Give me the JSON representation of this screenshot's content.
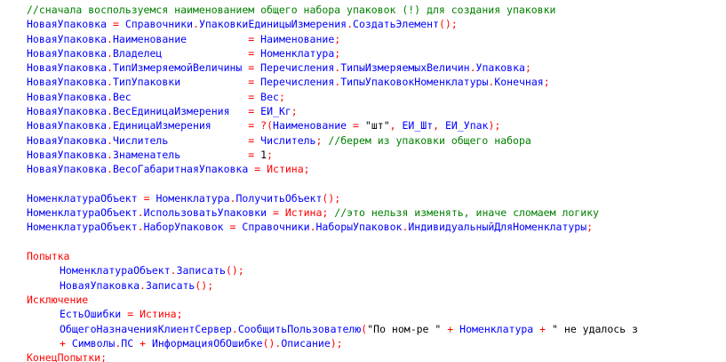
{
  "colors": {
    "identifier": "#0000ff",
    "operator": "#ff0000",
    "keyword": "#ff0000",
    "string": "#000000",
    "comment": "#008000",
    "background": "#ffffff"
  },
  "lines": [
    {
      "indent": 1,
      "tokens": [
        {
          "t": "cmt",
          "v": "//сначала воспользуемся наименованием общего набора упаковок (!) для создания упаковки"
        }
      ]
    },
    {
      "indent": 1,
      "tokens": [
        {
          "t": "ident",
          "v": "НоваяУпаковка"
        },
        {
          "t": "sp",
          "v": " "
        },
        {
          "t": "op",
          "v": "="
        },
        {
          "t": "sp",
          "v": " "
        },
        {
          "t": "ident",
          "v": "Справочники"
        },
        {
          "t": "op",
          "v": "."
        },
        {
          "t": "ident",
          "v": "УпаковкиЕдиницыИзмерения"
        },
        {
          "t": "op",
          "v": "."
        },
        {
          "t": "ident",
          "v": "СоздатьЭлемент"
        },
        {
          "t": "op",
          "v": "();"
        }
      ]
    },
    {
      "indent": 1,
      "tokens": [
        {
          "t": "ident",
          "v": "НоваяУпаковка"
        },
        {
          "t": "op",
          "v": "."
        },
        {
          "t": "ident",
          "v": "Наименование"
        },
        {
          "t": "sp",
          "v": "          "
        },
        {
          "t": "op",
          "v": "="
        },
        {
          "t": "sp",
          "v": " "
        },
        {
          "t": "ident",
          "v": "Наименование"
        },
        {
          "t": "op",
          "v": ";"
        }
      ]
    },
    {
      "indent": 1,
      "tokens": [
        {
          "t": "ident",
          "v": "НоваяУпаковка"
        },
        {
          "t": "op",
          "v": "."
        },
        {
          "t": "ident",
          "v": "Владелец"
        },
        {
          "t": "sp",
          "v": "              "
        },
        {
          "t": "op",
          "v": "="
        },
        {
          "t": "sp",
          "v": " "
        },
        {
          "t": "ident",
          "v": "Номенклатура"
        },
        {
          "t": "op",
          "v": ";"
        }
      ]
    },
    {
      "indent": 1,
      "tokens": [
        {
          "t": "ident",
          "v": "НоваяУпаковка"
        },
        {
          "t": "op",
          "v": "."
        },
        {
          "t": "ident",
          "v": "ТипИзмеряемойВеличины"
        },
        {
          "t": "sp",
          "v": " "
        },
        {
          "t": "op",
          "v": "="
        },
        {
          "t": "sp",
          "v": " "
        },
        {
          "t": "ident",
          "v": "Перечисления"
        },
        {
          "t": "op",
          "v": "."
        },
        {
          "t": "ident",
          "v": "ТипыИзмеряемыхВеличин"
        },
        {
          "t": "op",
          "v": "."
        },
        {
          "t": "ident",
          "v": "Упаковка"
        },
        {
          "t": "op",
          "v": ";"
        }
      ]
    },
    {
      "indent": 1,
      "tokens": [
        {
          "t": "ident",
          "v": "НоваяУпаковка"
        },
        {
          "t": "op",
          "v": "."
        },
        {
          "t": "ident",
          "v": "ТипУпаковки"
        },
        {
          "t": "sp",
          "v": "           "
        },
        {
          "t": "op",
          "v": "="
        },
        {
          "t": "sp",
          "v": " "
        },
        {
          "t": "ident",
          "v": "Перечисления"
        },
        {
          "t": "op",
          "v": "."
        },
        {
          "t": "ident",
          "v": "ТипыУпаковокНоменклатуры"
        },
        {
          "t": "op",
          "v": "."
        },
        {
          "t": "ident",
          "v": "Конечная"
        },
        {
          "t": "op",
          "v": ";"
        }
      ]
    },
    {
      "indent": 1,
      "tokens": [
        {
          "t": "ident",
          "v": "НоваяУпаковка"
        },
        {
          "t": "op",
          "v": "."
        },
        {
          "t": "ident",
          "v": "Вес"
        },
        {
          "t": "sp",
          "v": "                   "
        },
        {
          "t": "op",
          "v": "="
        },
        {
          "t": "sp",
          "v": " "
        },
        {
          "t": "ident",
          "v": "Вес"
        },
        {
          "t": "op",
          "v": ";"
        }
      ]
    },
    {
      "indent": 1,
      "tokens": [
        {
          "t": "ident",
          "v": "НоваяУпаковка"
        },
        {
          "t": "op",
          "v": "."
        },
        {
          "t": "ident",
          "v": "ВесЕдиницаИзмерения"
        },
        {
          "t": "sp",
          "v": "   "
        },
        {
          "t": "op",
          "v": "="
        },
        {
          "t": "sp",
          "v": " "
        },
        {
          "t": "ident",
          "v": "ЕИ_Кг"
        },
        {
          "t": "op",
          "v": ";"
        }
      ]
    },
    {
      "indent": 1,
      "tokens": [
        {
          "t": "ident",
          "v": "НоваяУпаковка"
        },
        {
          "t": "op",
          "v": "."
        },
        {
          "t": "ident",
          "v": "ЕдиницаИзмерения"
        },
        {
          "t": "sp",
          "v": "      "
        },
        {
          "t": "op",
          "v": "="
        },
        {
          "t": "sp",
          "v": " "
        },
        {
          "t": "op",
          "v": "?("
        },
        {
          "t": "ident",
          "v": "Наименование"
        },
        {
          "t": "sp",
          "v": " "
        },
        {
          "t": "op",
          "v": "="
        },
        {
          "t": "sp",
          "v": " "
        },
        {
          "t": "str",
          "v": "\"шт\""
        },
        {
          "t": "op",
          "v": ","
        },
        {
          "t": "sp",
          "v": " "
        },
        {
          "t": "ident",
          "v": "ЕИ_Шт"
        },
        {
          "t": "op",
          "v": ","
        },
        {
          "t": "sp",
          "v": " "
        },
        {
          "t": "ident",
          "v": "ЕИ_Упак"
        },
        {
          "t": "op",
          "v": ");"
        }
      ]
    },
    {
      "indent": 1,
      "tokens": [
        {
          "t": "ident",
          "v": "НоваяУпаковка"
        },
        {
          "t": "op",
          "v": "."
        },
        {
          "t": "ident",
          "v": "Числитель"
        },
        {
          "t": "sp",
          "v": "             "
        },
        {
          "t": "op",
          "v": "="
        },
        {
          "t": "sp",
          "v": " "
        },
        {
          "t": "ident",
          "v": "Числитель"
        },
        {
          "t": "op",
          "v": ";"
        },
        {
          "t": "sp",
          "v": " "
        },
        {
          "t": "cmt",
          "v": "//берем из упаковки общего набора"
        }
      ]
    },
    {
      "indent": 1,
      "tokens": [
        {
          "t": "ident",
          "v": "НоваяУпаковка"
        },
        {
          "t": "op",
          "v": "."
        },
        {
          "t": "ident",
          "v": "Знаменатель"
        },
        {
          "t": "sp",
          "v": "           "
        },
        {
          "t": "op",
          "v": "="
        },
        {
          "t": "sp",
          "v": " "
        },
        {
          "t": "num",
          "v": "1"
        },
        {
          "t": "op",
          "v": ";"
        }
      ]
    },
    {
      "indent": 1,
      "tokens": [
        {
          "t": "ident",
          "v": "НоваяУпаковка"
        },
        {
          "t": "op",
          "v": "."
        },
        {
          "t": "ident",
          "v": "ВесоГабаритнаяУпаковка"
        },
        {
          "t": "sp",
          "v": " "
        },
        {
          "t": "op",
          "v": "="
        },
        {
          "t": "sp",
          "v": " "
        },
        {
          "t": "kw",
          "v": "Истина"
        },
        {
          "t": "op",
          "v": ";"
        }
      ]
    },
    {
      "indent": 1,
      "tokens": []
    },
    {
      "indent": 1,
      "tokens": [
        {
          "t": "ident",
          "v": "НоменклатураОбъект"
        },
        {
          "t": "sp",
          "v": " "
        },
        {
          "t": "op",
          "v": "="
        },
        {
          "t": "sp",
          "v": " "
        },
        {
          "t": "ident",
          "v": "Номенклатура"
        },
        {
          "t": "op",
          "v": "."
        },
        {
          "t": "ident",
          "v": "ПолучитьОбъект"
        },
        {
          "t": "op",
          "v": "();"
        }
      ]
    },
    {
      "indent": 1,
      "tokens": [
        {
          "t": "ident",
          "v": "НоменклатураОбъект"
        },
        {
          "t": "op",
          "v": "."
        },
        {
          "t": "ident",
          "v": "ИспользоватьУпаковки"
        },
        {
          "t": "sp",
          "v": " "
        },
        {
          "t": "op",
          "v": "="
        },
        {
          "t": "sp",
          "v": " "
        },
        {
          "t": "kw",
          "v": "Истина"
        },
        {
          "t": "op",
          "v": ";"
        },
        {
          "t": "sp",
          "v": " "
        },
        {
          "t": "cmt",
          "v": "//это нельзя изменять, иначе сломаем логику"
        }
      ]
    },
    {
      "indent": 1,
      "tokens": [
        {
          "t": "ident",
          "v": "НоменклатураОбъект"
        },
        {
          "t": "op",
          "v": "."
        },
        {
          "t": "ident",
          "v": "НаборУпаковок"
        },
        {
          "t": "sp",
          "v": " "
        },
        {
          "t": "op",
          "v": "="
        },
        {
          "t": "sp",
          "v": " "
        },
        {
          "t": "ident",
          "v": "Справочники"
        },
        {
          "t": "op",
          "v": "."
        },
        {
          "t": "ident",
          "v": "НаборыУпаковок"
        },
        {
          "t": "op",
          "v": "."
        },
        {
          "t": "ident",
          "v": "ИндивидуальныйДляНоменклатуры"
        },
        {
          "t": "op",
          "v": ";"
        }
      ]
    },
    {
      "indent": 1,
      "tokens": []
    },
    {
      "indent": 1,
      "tokens": [
        {
          "t": "kw",
          "v": "Попытка"
        }
      ]
    },
    {
      "indent": 2,
      "tokens": [
        {
          "t": "ident",
          "v": "НоменклатураОбъект"
        },
        {
          "t": "op",
          "v": "."
        },
        {
          "t": "ident",
          "v": "Записать"
        },
        {
          "t": "op",
          "v": "();"
        }
      ]
    },
    {
      "indent": 2,
      "tokens": [
        {
          "t": "ident",
          "v": "НоваяУпаковка"
        },
        {
          "t": "op",
          "v": "."
        },
        {
          "t": "ident",
          "v": "Записать"
        },
        {
          "t": "op",
          "v": "();"
        }
      ]
    },
    {
      "indent": 1,
      "tokens": [
        {
          "t": "kw",
          "v": "Исключение"
        }
      ]
    },
    {
      "indent": 2,
      "tokens": [
        {
          "t": "ident",
          "v": "ЕстьОшибки"
        },
        {
          "t": "sp",
          "v": " "
        },
        {
          "t": "op",
          "v": "="
        },
        {
          "t": "sp",
          "v": " "
        },
        {
          "t": "kw",
          "v": "Истина"
        },
        {
          "t": "op",
          "v": ";"
        }
      ]
    },
    {
      "indent": 2,
      "tokens": [
        {
          "t": "ident",
          "v": "ОбщегоНазначенияКлиентСервер"
        },
        {
          "t": "op",
          "v": "."
        },
        {
          "t": "ident",
          "v": "СообщитьПользователю"
        },
        {
          "t": "op",
          "v": "("
        },
        {
          "t": "str",
          "v": "\"По ном-ре \""
        },
        {
          "t": "sp",
          "v": " "
        },
        {
          "t": "op",
          "v": "+"
        },
        {
          "t": "sp",
          "v": " "
        },
        {
          "t": "ident",
          "v": "Номенклатура"
        },
        {
          "t": "sp",
          "v": " "
        },
        {
          "t": "op",
          "v": "+"
        },
        {
          "t": "sp",
          "v": " "
        },
        {
          "t": "str",
          "v": "\" не удалось з"
        }
      ]
    },
    {
      "indent": 2,
      "tokens": [
        {
          "t": "op",
          "v": "+"
        },
        {
          "t": "sp",
          "v": " "
        },
        {
          "t": "ident",
          "v": "Символы"
        },
        {
          "t": "op",
          "v": "."
        },
        {
          "t": "ident",
          "v": "ПС"
        },
        {
          "t": "sp",
          "v": " "
        },
        {
          "t": "op",
          "v": "+"
        },
        {
          "t": "sp",
          "v": " "
        },
        {
          "t": "ident",
          "v": "ИнформацияОбОшибке"
        },
        {
          "t": "op",
          "v": "()."
        },
        {
          "t": "ident",
          "v": "Описание"
        },
        {
          "t": "op",
          "v": ");"
        }
      ]
    },
    {
      "indent": 1,
      "tokens": [
        {
          "t": "kw",
          "v": "КонецПопытки"
        },
        {
          "t": "op",
          "v": ";"
        }
      ]
    }
  ]
}
